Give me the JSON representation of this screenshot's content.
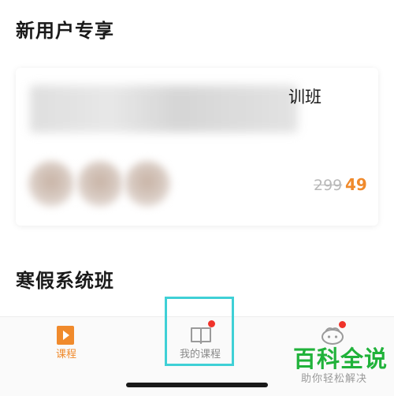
{
  "sections": {
    "new_user_title": "新用户专享",
    "winter_title": "寒假系统班"
  },
  "course_card": {
    "title_visible_tail": "训班",
    "price_original": "299",
    "price_current": "49",
    "accent_color": "#f08a2c"
  },
  "tabbar": {
    "tabs": [
      {
        "label": "课程",
        "icon": "play-icon",
        "active": true
      },
      {
        "label": "我的课程",
        "icon": "book-icon",
        "active": false,
        "badge": true
      },
      {
        "label": "",
        "icon": "face-icon",
        "active": false,
        "badge": true
      }
    ],
    "active_color": "#f08a2c",
    "inactive_color": "#8a8a8a",
    "badge_color": "#f0332b"
  },
  "highlight_color": "#3fd0d6",
  "watermark": {
    "main": "百科全说",
    "sub": "助你轻松解决"
  }
}
